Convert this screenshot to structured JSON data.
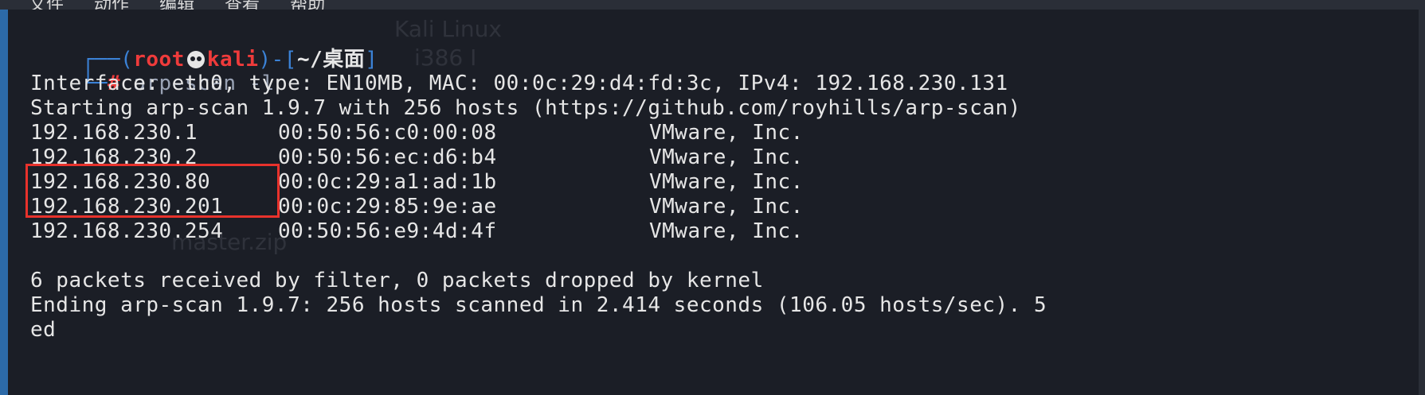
{
  "menu": {
    "items": [
      "文件",
      "动作",
      "编辑",
      "查看",
      "帮助"
    ]
  },
  "prompt": {
    "open_paren": "┌──(",
    "user": "root",
    "host": "kali",
    "close_paren": ")-[",
    "path": "~/桌面",
    "close_bracket": "]",
    "line2_prefix": "└─",
    "hash": "#",
    "command": "arp-scan -l"
  },
  "output": {
    "interface_line": "Interface: eth0, type: EN10MB, MAC: 00:0c:29:d4:fd:3c, IPv4: 192.168.230.131",
    "starting_line": "Starting arp-scan 1.9.7 with 256 hosts (https://github.com/royhills/arp-scan)",
    "hosts": [
      {
        "ip": "192.168.230.1",
        "mac": "00:50:56:c0:00:08",
        "vendor": "VMware, Inc."
      },
      {
        "ip": "192.168.230.2",
        "mac": "00:50:56:ec:d6:b4",
        "vendor": "VMware, Inc."
      },
      {
        "ip": "192.168.230.80",
        "mac": "00:0c:29:a1:ad:1b",
        "vendor": "VMware, Inc."
      },
      {
        "ip": "192.168.230.201",
        "mac": "00:0c:29:85:9e:ae",
        "vendor": "VMware, Inc."
      },
      {
        "ip": "192.168.230.254",
        "mac": "00:50:56:e9:4d:4f",
        "vendor": "VMware, Inc."
      }
    ],
    "packets_line": "6 packets received by filter, 0 packets dropped by kernel",
    "ending_line": "Ending arp-scan 1.9.7: 256 hosts scanned in 2.414 seconds (106.05 hosts/sec). 5",
    "wrap_line": "ed"
  },
  "background_ghosts": {
    "kali": "Kali Linux",
    "arch": "i386 I",
    "zip": "master.zip"
  },
  "colors": {
    "background": "#1b1e26",
    "prompt_blue": "#3b82d6",
    "prompt_red": "#ef3b3b",
    "highlight_box": "#e8322c"
  }
}
